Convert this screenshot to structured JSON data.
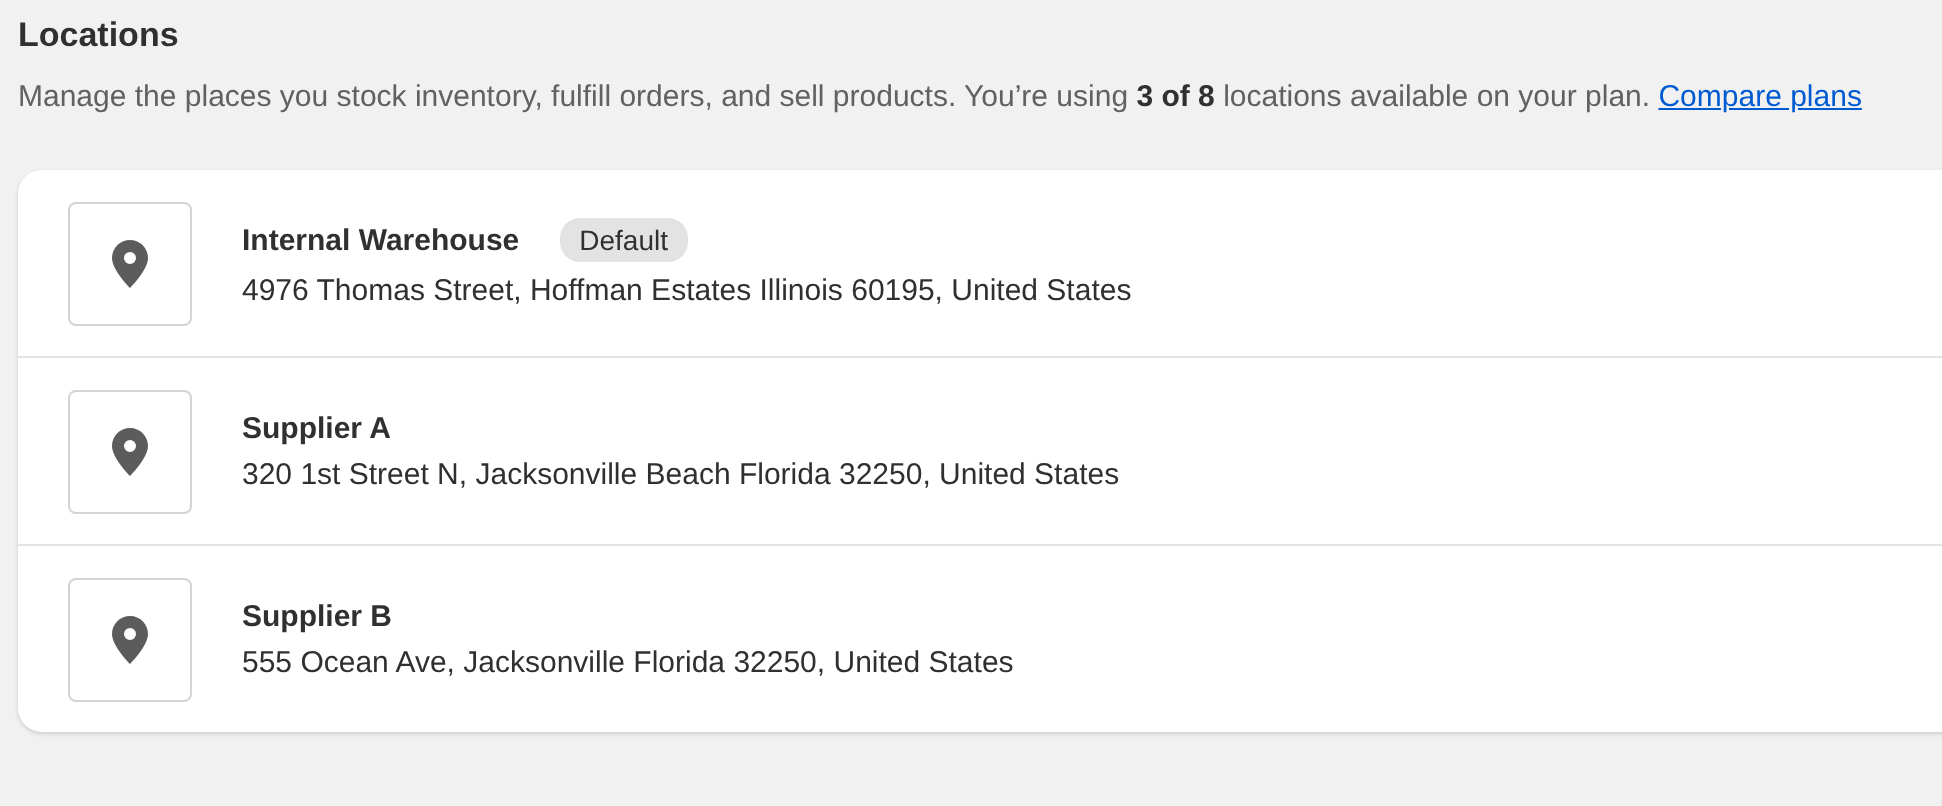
{
  "title": "Locations",
  "description": "Manage the places you stock inventory, fulfill orders, and sell products. You’re using **3 of 8** locations available on your plan.",
  "link": "Compare plans",
  "locations": [
    {
      "name": "Internal Warehouse",
      "badge": "Default",
      "address": "4976 Thomas Street, Hoffman Estates Illinois 60195, United States"
    },
    {
      "name": "Supplier A",
      "address": "320 1st Street N, Jacksonville Beach Florida 32250, United States"
    },
    {
      "name": "Supplier B",
      "address": "555 Ocean Ave, Jacksonville Florida 32250, United States"
    }
  ]
}
